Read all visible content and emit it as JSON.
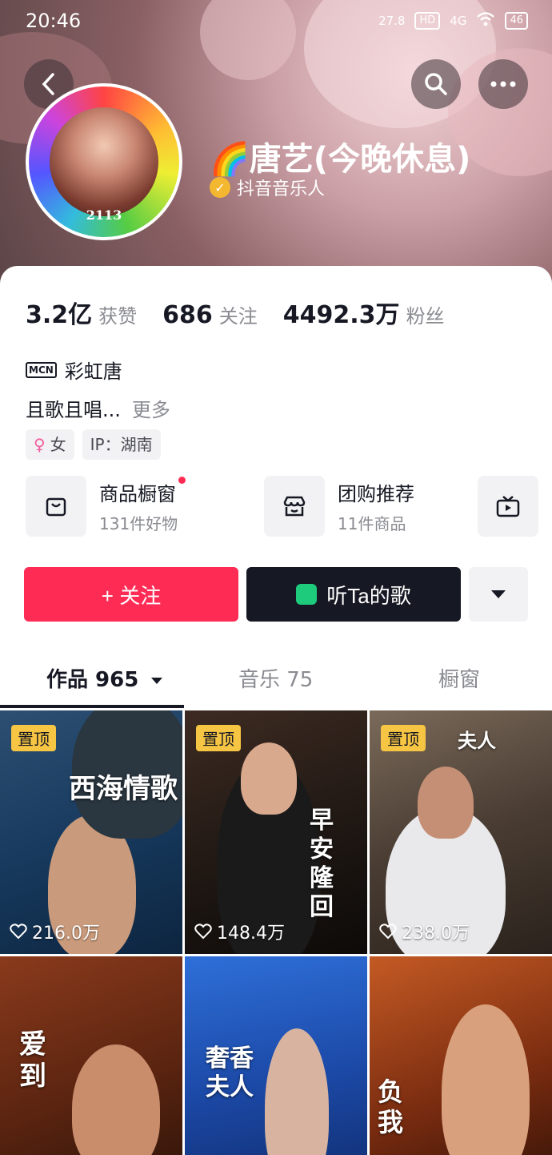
{
  "status_bar": {
    "time": "20:46",
    "net_speed": "27.8",
    "hd": "HD",
    "signal": "4G",
    "battery": "46"
  },
  "profile": {
    "nickname": "🌈唐艺(今晚休息)",
    "verification": "抖音音乐人",
    "avatar_number": "2113"
  },
  "stats": [
    {
      "value": "3.2亿",
      "label": "获赞"
    },
    {
      "value": "686",
      "label": "关注"
    },
    {
      "value": "4492.3万",
      "label": "粉丝"
    }
  ],
  "mcn": {
    "badge": "MCN",
    "name": "彩虹唐"
  },
  "bio": {
    "text": "且歌且唱...",
    "more": "更多"
  },
  "tags": {
    "gender": "女",
    "ip": "IP：湖南"
  },
  "services": [
    {
      "title": "商品橱窗",
      "subtitle": "131件好物"
    },
    {
      "title": "团购推荐",
      "subtitle": "11件商品"
    }
  ],
  "actions": {
    "follow": "+ 关注",
    "listen": "听Ta的歌"
  },
  "tabs": [
    {
      "label": "作品 965"
    },
    {
      "label": "音乐 75"
    },
    {
      "label": "橱窗"
    }
  ],
  "videos": [
    {
      "pinned": "置顶",
      "likes": "216.0万",
      "title": "西海情歌"
    },
    {
      "pinned": "置顶",
      "likes": "148.4万",
      "title": "早安隆回"
    },
    {
      "pinned": "置顶",
      "likes": "238.0万",
      "title": "夫人"
    },
    {
      "title": "爱到"
    },
    {
      "title": "奢香夫人"
    },
    {
      "title": "负我"
    }
  ],
  "colors": {
    "accent": "#fe2c55",
    "dark_button": "#161823",
    "pin": "#f6c543"
  }
}
